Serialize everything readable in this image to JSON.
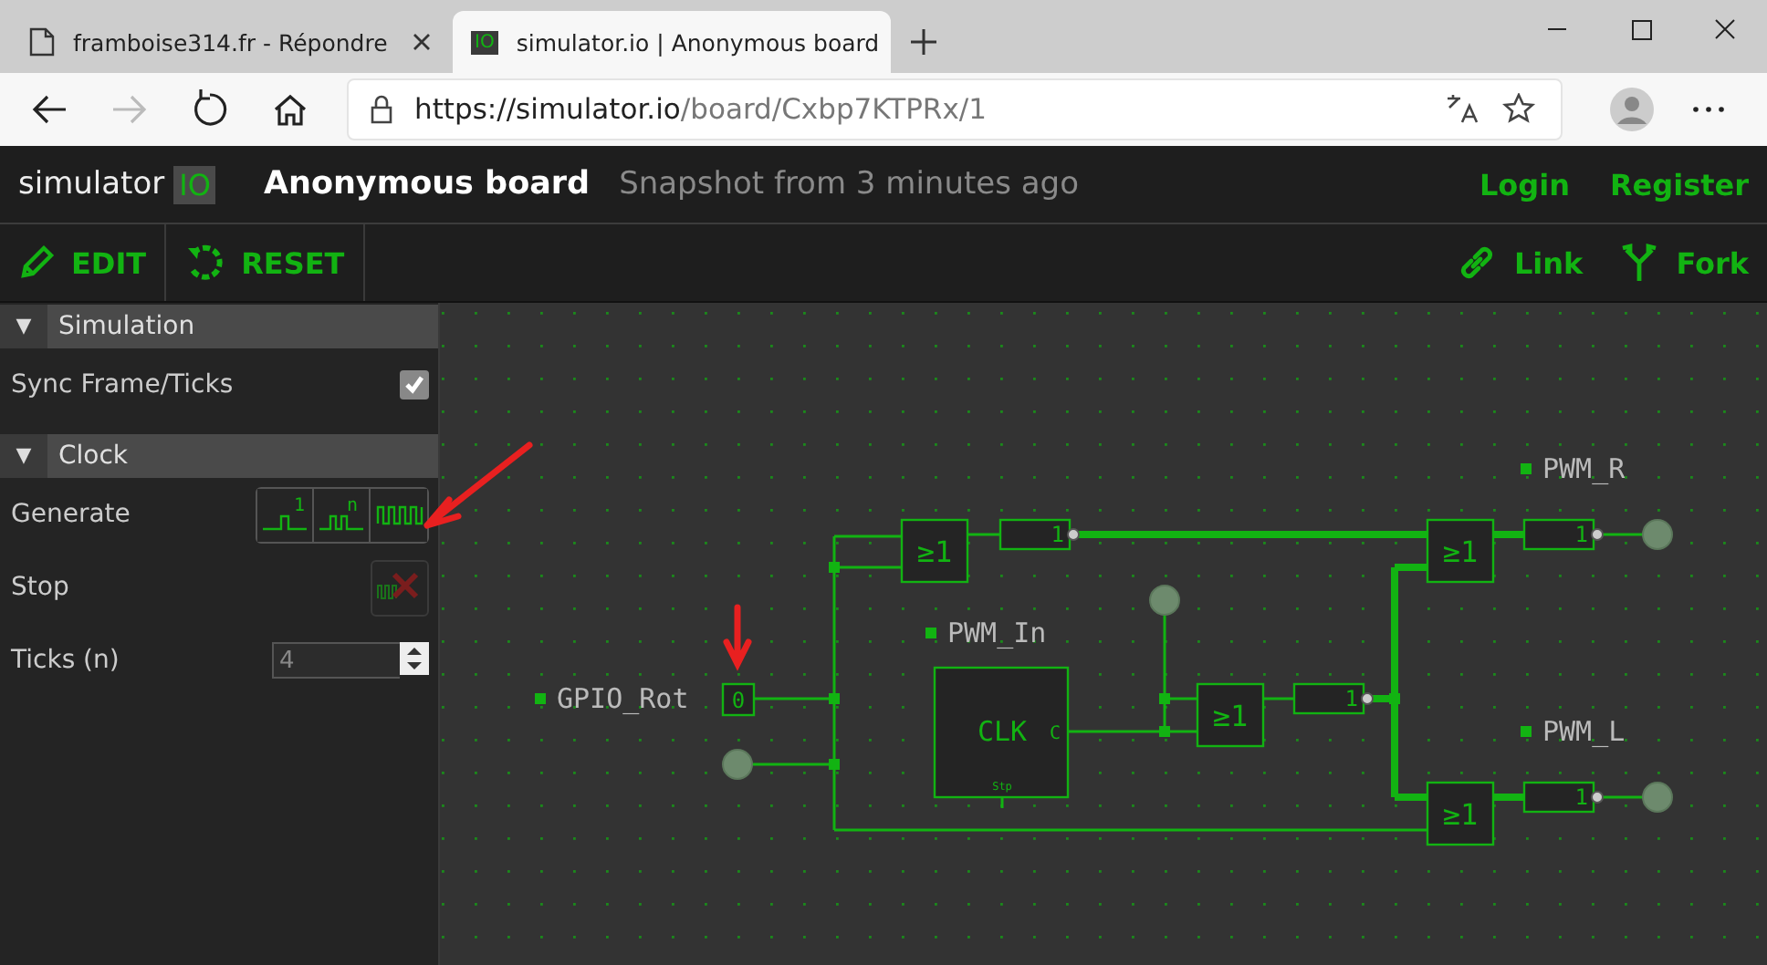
{
  "browser": {
    "tabs": [
      {
        "title": "framboise314.fr - Répondre",
        "selected": false
      },
      {
        "title": "simulator.io | Anonymous board",
        "favicon": "IO",
        "selected": true
      }
    ],
    "url_host": "https://simulator.io",
    "url_path": "/board/Cxbp7KTPRx/1"
  },
  "header": {
    "logo_text": "simulator",
    "logo_badge": "IO",
    "title": "Anonymous board",
    "subtitle": "Snapshot from 3 minutes ago",
    "links": [
      "Login",
      "Register"
    ]
  },
  "toolbar": {
    "left": [
      {
        "kind": "edit",
        "label": "EDIT"
      },
      {
        "kind": "reset",
        "label": "RESET"
      }
    ],
    "right": [
      {
        "kind": "link",
        "label": "Link"
      },
      {
        "kind": "fork",
        "label": "Fork"
      }
    ]
  },
  "sidebar": [
    {
      "toggle": "▼",
      "title": "Simulation",
      "rows": [
        {
          "kind": "checkbox",
          "label": "Sync Frame/Ticks",
          "checked": true
        }
      ]
    },
    {
      "toggle": "▼",
      "title": "Clock",
      "rows": [
        {
          "kind": "generate",
          "label": "Generate",
          "buttons": [
            "1",
            "n"
          ]
        },
        {
          "kind": "stop",
          "label": "Stop",
          "disabled": true
        },
        {
          "kind": "number",
          "label": "Ticks (n)",
          "value": "4"
        }
      ]
    }
  ],
  "circuit": {
    "labels": [
      "GPIO_Rot",
      "PWM_In",
      "PWM_R",
      "PWM_L"
    ],
    "switch_value": "0",
    "switch_on": false,
    "gates": [
      "≥1",
      "≥1",
      "≥1",
      "≥1"
    ],
    "buffers": [
      "1",
      "1",
      "1",
      "1"
    ],
    "clock": {
      "title": "CLK",
      "out_pin": "C",
      "stop_pin": "Stp"
    }
  }
}
